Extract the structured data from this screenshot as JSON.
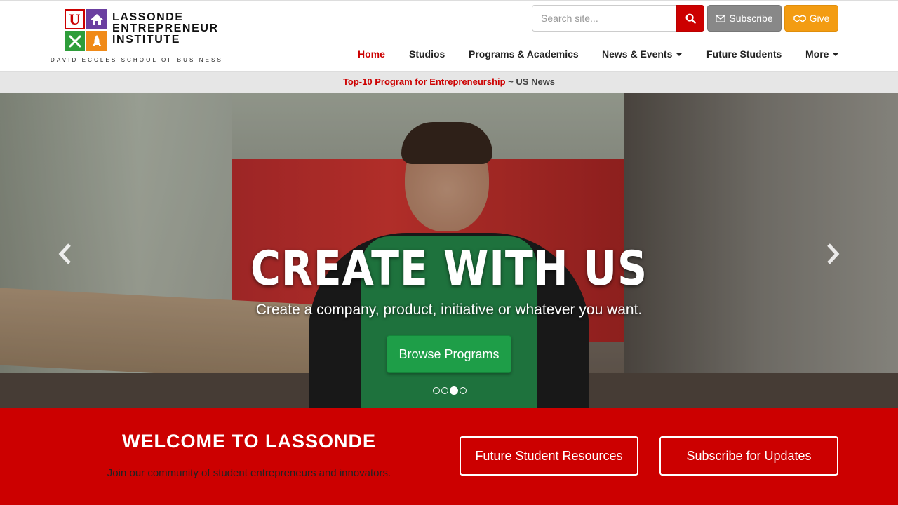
{
  "brand": {
    "logo_text_line1": "LASSONDE",
    "logo_text_line2": "ENTREPRENEUR",
    "logo_text_line3": "INSTITUTE",
    "logo_subtext": "DAVID ECCLES SCHOOL OF BUSINESS",
    "logo_letter": "U"
  },
  "header": {
    "search_placeholder": "Search site...",
    "subscribe_label": "Subscribe",
    "give_label": "Give"
  },
  "nav": {
    "items": [
      {
        "label": "Home",
        "active": true
      },
      {
        "label": "Studios"
      },
      {
        "label": "Programs & Academics"
      },
      {
        "label": "News & Events",
        "dropdown": true
      },
      {
        "label": "Future Students"
      },
      {
        "label": "More",
        "dropdown": true
      }
    ]
  },
  "notice": {
    "highlight": "Top-10 Program for Entrepreneurship",
    "rest": " ~ US News"
  },
  "hero": {
    "title": "CREATE WITH US",
    "subtitle": "Create a company, product, initiative or whatever you want.",
    "button_label": "Browse Programs",
    "slides": 4,
    "active_slide": 3
  },
  "welcome": {
    "title": "WELCOME TO LASSONDE",
    "subtitle": "Join our community of student entrepreneurs and innovators.",
    "button1_label": "Future Student Resources",
    "button2_label": "Subscribe for Updates"
  },
  "colors": {
    "brand_red": "#cc0000",
    "give_orange": "#f39c12",
    "subscribe_gray": "#888888",
    "cta_green": "#1e9e48"
  },
  "icons": [
    "search-icon",
    "envelope-icon",
    "handshake-icon",
    "chevron-left-icon",
    "chevron-right-icon"
  ]
}
